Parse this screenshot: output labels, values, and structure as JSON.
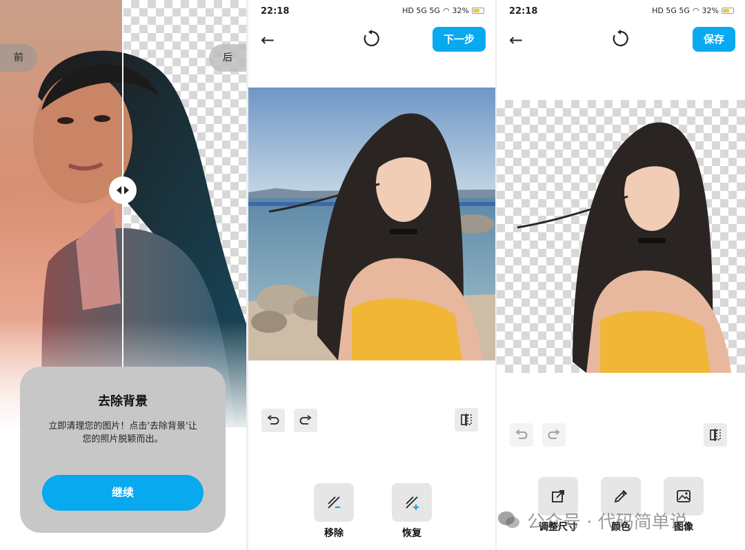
{
  "panel1": {
    "before_label": "前",
    "after_label": "后",
    "card": {
      "title": "去除背景",
      "desc_line1": "立即清理您的图片！点击'去除背景'让",
      "desc_line2": "您的照片脱颖而出。",
      "continue_label": "继续"
    }
  },
  "panel2": {
    "time": "22:18",
    "battery": "32%",
    "signal": "HD 5G 5G",
    "next_label": "下一步",
    "actions": [
      {
        "label": "移除",
        "icon": "eraser-minus-icon"
      },
      {
        "label": "恢复",
        "icon": "eraser-plus-icon"
      }
    ]
  },
  "panel3": {
    "time": "22:18",
    "battery": "32%",
    "signal": "HD 5G 5G",
    "save_label": "保存",
    "actions": [
      {
        "label": "调整尺寸",
        "icon": "resize-icon"
      },
      {
        "label": "颜色",
        "icon": "eyedropper-icon"
      },
      {
        "label": "图像",
        "icon": "image-icon"
      }
    ]
  },
  "watermark": "公众号 · 代码简单说",
  "colors": {
    "accent": "#08a9ef",
    "card_bg": "#c7c7c7",
    "tool_bg": "#ebebeb"
  }
}
